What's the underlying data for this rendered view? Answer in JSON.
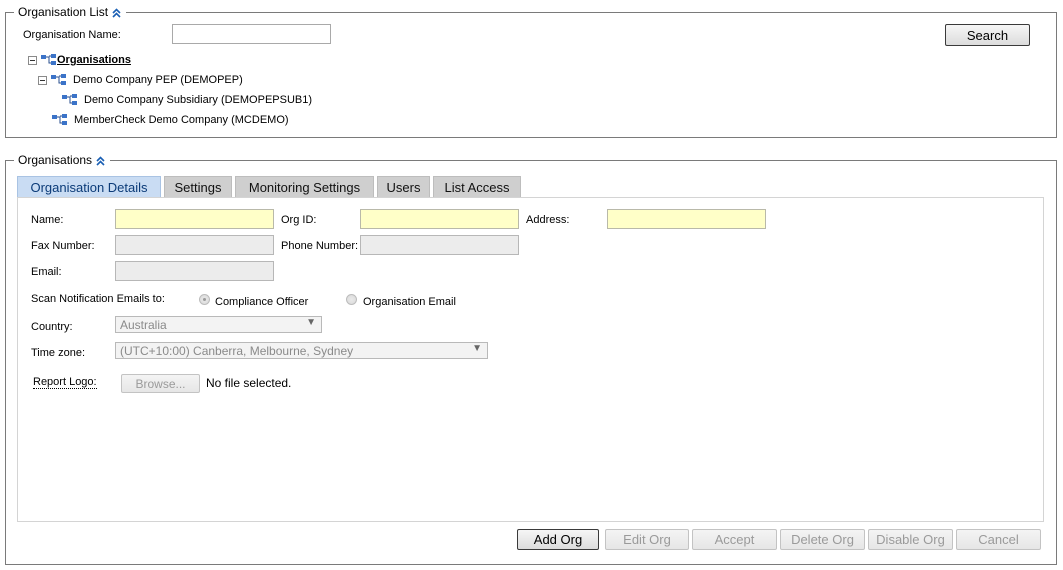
{
  "org_list": {
    "title": "Organisation List",
    "name_label": "Organisation Name:",
    "name_value": "",
    "search_label": "Search",
    "tree": {
      "root": "Organisations",
      "items": [
        {
          "label": "Demo Company PEP (DEMOPEP)"
        },
        {
          "label": "Demo Company Subsidiary (DEMOPEPSUB1)"
        },
        {
          "label": "MemberCheck Demo Company (MCDEMO)"
        }
      ]
    }
  },
  "orgs": {
    "title": "Organisations",
    "tabs": [
      {
        "label": "Organisation Details"
      },
      {
        "label": "Settings"
      },
      {
        "label": "Monitoring Settings"
      },
      {
        "label": "Users"
      },
      {
        "label": "List Access"
      }
    ],
    "form": {
      "name_label": "Name:",
      "orgid_label": "Org ID:",
      "address_label": "Address:",
      "fax_label": "Fax Number:",
      "phone_label": "Phone Number:",
      "email_label": "Email:",
      "scan_label": "Scan Notification Emails to:",
      "radio_compliance": "Compliance Officer",
      "radio_org_email": "Organisation Email",
      "country_label": "Country:",
      "country_value": "Australia",
      "timezone_label": "Time zone:",
      "timezone_value": "(UTC+10:00) Canberra, Melbourne, Sydney",
      "logo_label": "Report Logo:",
      "browse_label": "Browse...",
      "file_status": "No file selected."
    },
    "actions": {
      "add": "Add Org",
      "edit": "Edit Org",
      "accept": "Accept",
      "delete": "Delete Org",
      "disable": "Disable Org",
      "cancel": "Cancel"
    }
  }
}
